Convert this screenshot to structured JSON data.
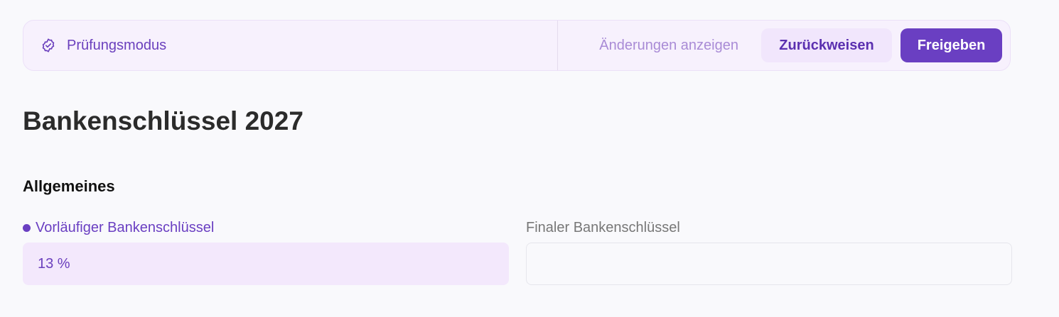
{
  "review_bar": {
    "mode_icon": "check-badge-icon",
    "mode_label": "Prüfungsmodus",
    "show_changes_label": "Änderungen anzeigen",
    "reject_label": "Zurückweisen",
    "approve_label": "Freigeben"
  },
  "page": {
    "title": "Bankenschlüssel 2027"
  },
  "section": {
    "title": "Allgemeines",
    "fields": [
      {
        "label": "Vorläufiger Bankenschlüssel",
        "value": "13 %",
        "changed": true
      },
      {
        "label": "Finaler Bankenschlüssel",
        "value": "",
        "changed": false
      }
    ]
  },
  "colors": {
    "accent": "#6a3fc2",
    "accent_light": "#f3e8fc",
    "background": "#f9f9fc"
  }
}
